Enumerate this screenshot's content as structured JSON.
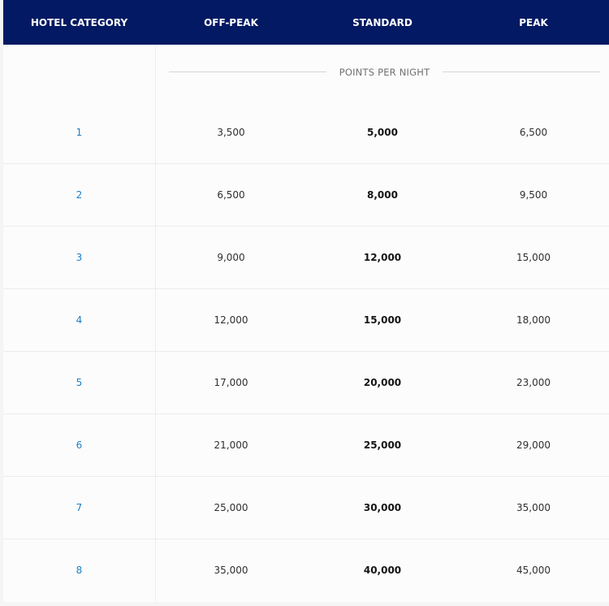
{
  "header": {
    "columns": [
      "HOTEL CATEGORY",
      "OFF-PEAK",
      "STANDARD",
      "PEAK"
    ]
  },
  "subheader": {
    "points_label": "POINTS PER NIGHT"
  },
  "rows": [
    {
      "category": "1",
      "off_peak": "3,500",
      "standard": "5,000",
      "peak": "6,500"
    },
    {
      "category": "2",
      "off_peak": "6,500",
      "standard": "8,000",
      "peak": "9,500"
    },
    {
      "category": "3",
      "off_peak": "9,000",
      "standard": "12,000",
      "peak": "15,000"
    },
    {
      "category": "4",
      "off_peak": "12,000",
      "standard": "15,000",
      "peak": "18,000"
    },
    {
      "category": "5",
      "off_peak": "17,000",
      "standard": "20,000",
      "peak": "23,000"
    },
    {
      "category": "6",
      "off_peak": "21,000",
      "standard": "25,000",
      "peak": "29,000"
    },
    {
      "category": "7",
      "off_peak": "25,000",
      "standard": "30,000",
      "peak": "35,000"
    },
    {
      "category": "8",
      "off_peak": "35,000",
      "standard": "40,000",
      "peak": "45,000"
    }
  ],
  "colors": {
    "header_bg": "#031963",
    "header_text": "#ffffff",
    "category_link": "#1b7fc9"
  }
}
